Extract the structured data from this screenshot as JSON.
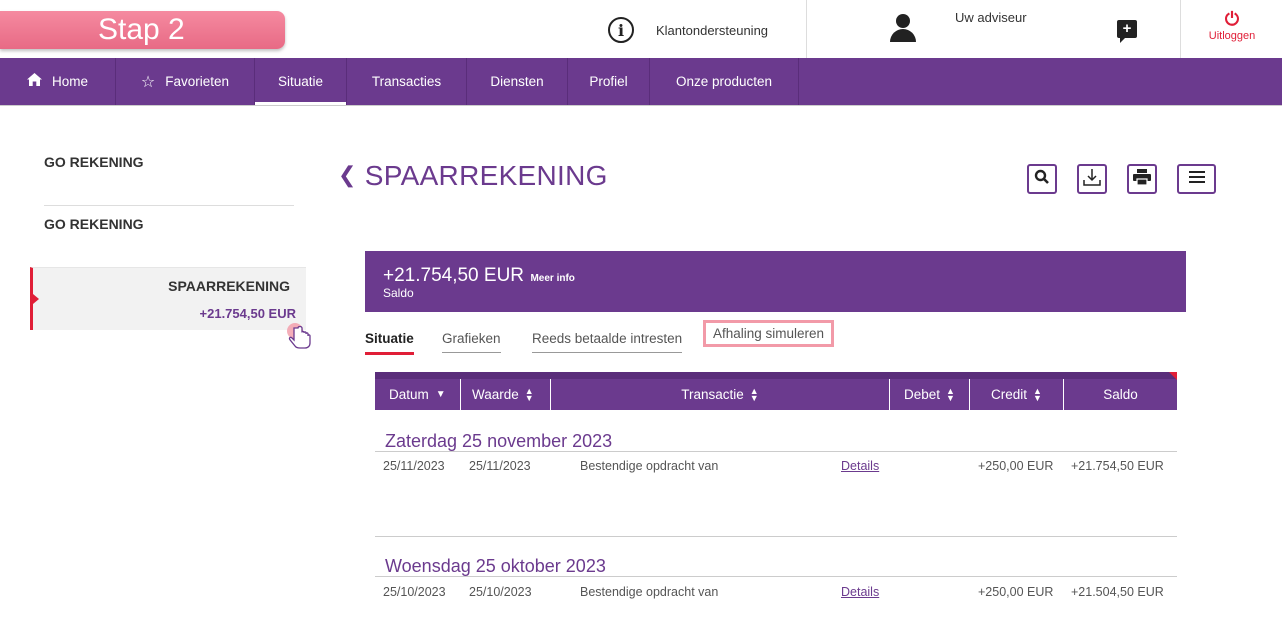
{
  "step_badge": "Stap 2",
  "header": {
    "support_label": "Klantondersteuning",
    "adviseur_label": "Uw adviseur",
    "logout_label": "Uitloggen"
  },
  "nav": [
    {
      "label": "Home",
      "icon": "home-icon"
    },
    {
      "label": "Favorieten",
      "icon": "star-icon"
    },
    {
      "label": "Situatie"
    },
    {
      "label": "Transacties"
    },
    {
      "label": "Diensten"
    },
    {
      "label": "Profiel"
    },
    {
      "label": "Onze producten"
    }
  ],
  "sidebar": {
    "group1": "GO REKENING",
    "group2": "GO REKENING",
    "active_title": "SPAARREKENING",
    "active_value": "+21.754,50 EUR"
  },
  "main": {
    "title": "SPAARREKENING",
    "balance_amount": "+21.754,50 EUR",
    "balance_more": "Meer info",
    "balance_label": "Saldo",
    "tabs": [
      "Situatie",
      "Grafieken",
      "Reeds betaalde intresten",
      "Afhaling simuleren"
    ],
    "columns": [
      "Datum",
      "Waarde",
      "Transactie",
      "Debet",
      "Credit",
      "Saldo"
    ],
    "groups": [
      {
        "day": "Zaterdag 25 november 2023",
        "rows": [
          {
            "datum": "25/11/2023",
            "waarde": "25/11/2023",
            "transactie": "Bestendige opdracht van",
            "details": "Details",
            "debet": "",
            "credit": "+250,00 EUR",
            "saldo": "+21.754,50 EUR"
          }
        ]
      },
      {
        "day": "Woensdag 25 oktober 2023",
        "rows": [
          {
            "datum": "25/10/2023",
            "waarde": "25/10/2023",
            "transactie": "Bestendige opdracht van",
            "details": "Details",
            "debet": "",
            "credit": "+250,00 EUR",
            "saldo": "+21.504,50 EUR"
          }
        ]
      }
    ]
  },
  "colors": {
    "brand": "#6b3a8e",
    "accent": "#e01e37",
    "step_badge": "#ec7790"
  }
}
